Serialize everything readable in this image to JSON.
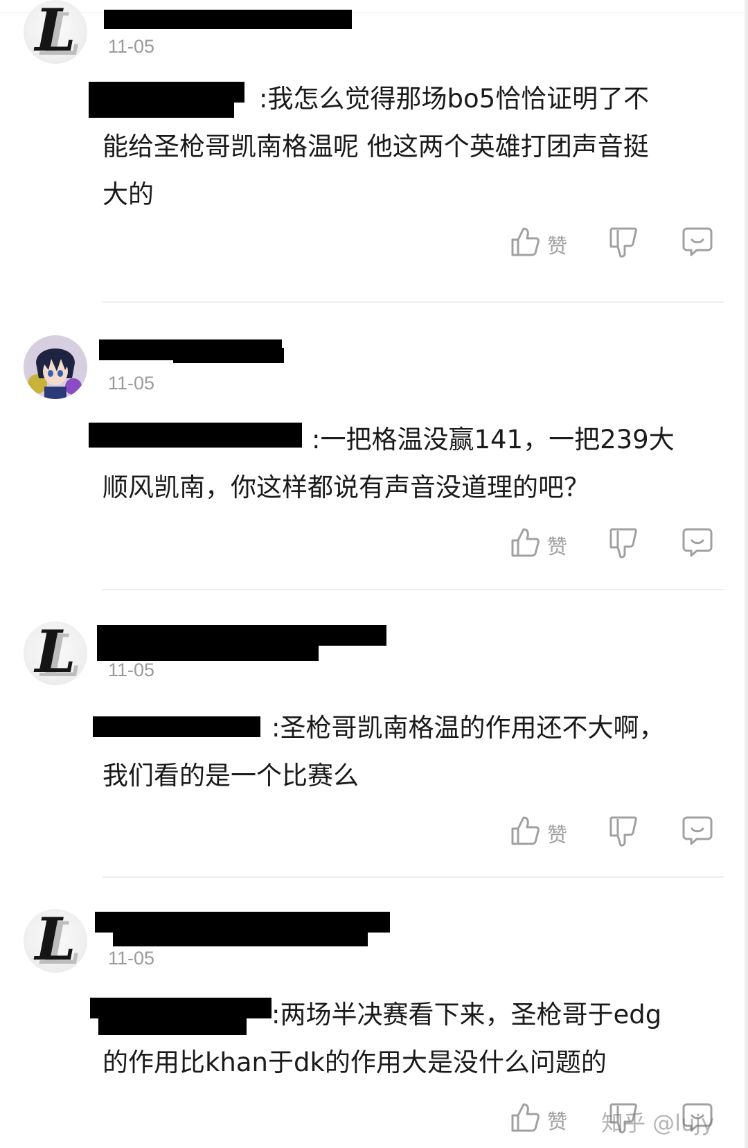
{
  "comments": [
    {
      "date": "11-05",
      "text_line1": ":我怎么觉得那场bo5恰恰证明了不",
      "text_rest": [
        "能给圣枪哥凯南格温呢 他这两个英雄打团声音挺",
        "大的"
      ],
      "like_label": "赞"
    },
    {
      "date": "11-05",
      "text_line1": ":一把格温没赢141，一把239大",
      "text_rest": [
        "顺风凯南，你这样都说有声音没道理的吧？"
      ],
      "like_label": "赞"
    },
    {
      "date": "11-05",
      "text_line1": ":圣枪哥凯南格温的作用还不大啊，",
      "text_rest": [
        "我们看的是一个比赛么"
      ],
      "like_label": "赞"
    },
    {
      "date": "11-05",
      "text_line1": ":两场半决赛看下来，圣枪哥于edg",
      "text_rest": [
        "的作用比khan于dk的作用大是没什么问题的"
      ],
      "like_label": "赞"
    }
  ],
  "watermark": "知乎 @lujy",
  "icons": {
    "like": "thumbs-up-icon",
    "dislike": "thumbs-down-icon",
    "reply": "comment-bubble-icon"
  },
  "colors": {
    "text": "#1a1a1a",
    "meta": "#9a9a9a",
    "icon": "#a0a0a0",
    "divider": "#eeeeee",
    "redaction": "#000000"
  }
}
